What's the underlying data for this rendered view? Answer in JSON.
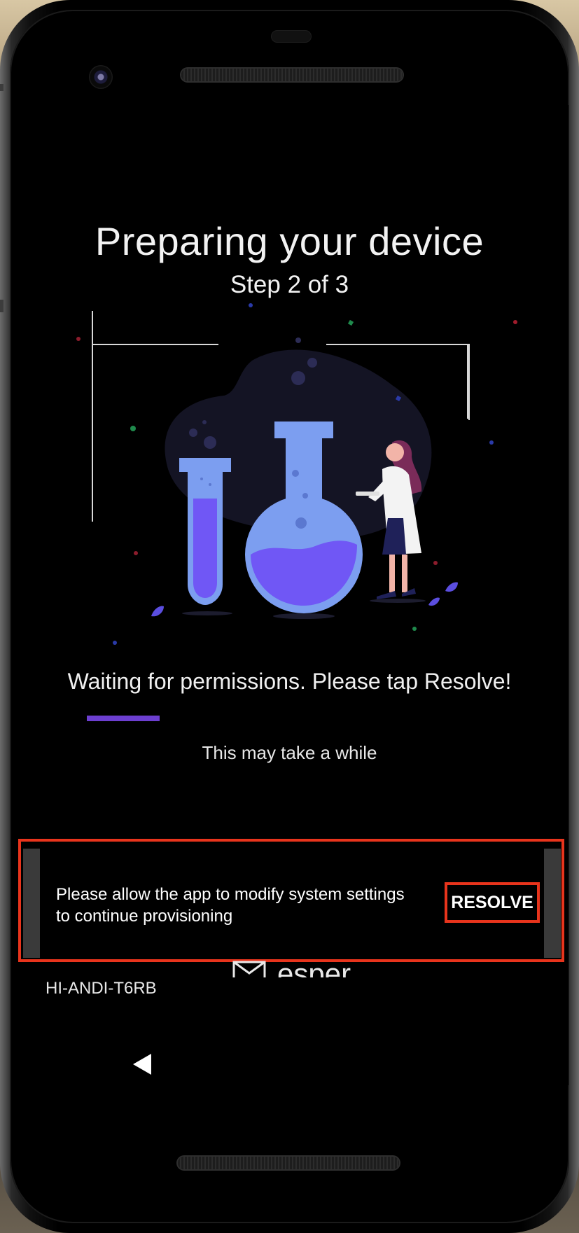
{
  "screen": {
    "title": "Preparing your device",
    "step": "Step 2 of 3",
    "status_message": "Waiting for permissions. Please tap Resolve!",
    "progress_fraction": 0.18,
    "note": "This may take a while"
  },
  "snackbar": {
    "message": "Please allow the app to modify system settings to continue provisioning",
    "action_label": "RESOLVE"
  },
  "branding": {
    "name": "esper"
  },
  "device": {
    "id": "HI-ANDI-T6RB"
  },
  "colors": {
    "progress": "#6c3fd0",
    "highlight": "#e8341c",
    "flask": "#7c9ef0",
    "liquid": "#7057f5"
  },
  "icons": {
    "back": "back-triangle-icon",
    "illustration": "scientist-flask-illustration"
  }
}
